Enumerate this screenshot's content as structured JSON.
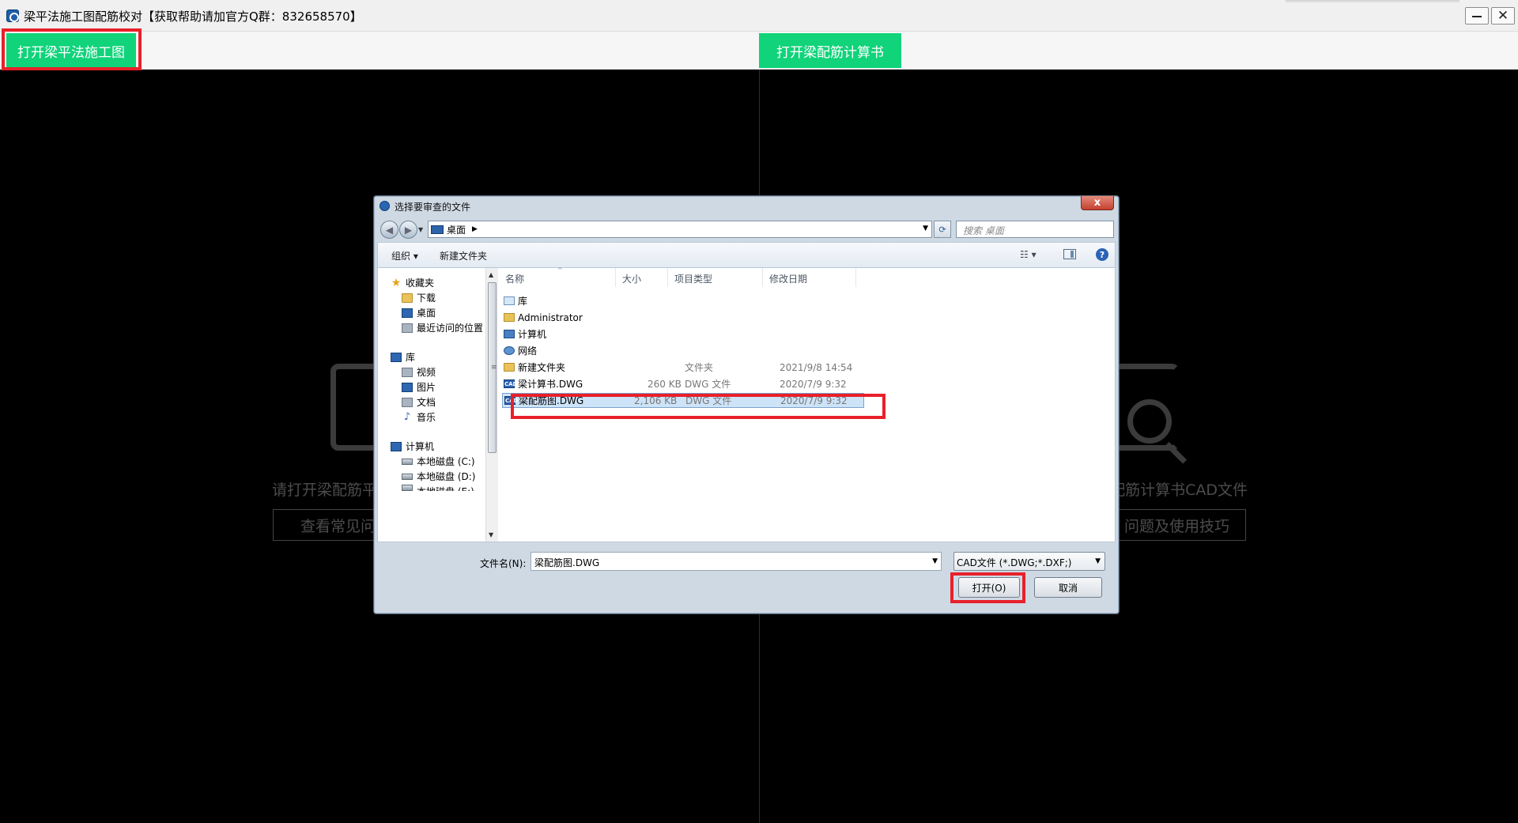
{
  "window": {
    "title": "梁平法施工图配筋校对【获取帮助请加官方Q群：832658570】",
    "minimize": "",
    "close": "✕"
  },
  "toolbar": {
    "open_plan_label": "打开梁平法施工图",
    "open_calc_label": "打开梁配筋计算书"
  },
  "placeholder": {
    "left_text": "请打开梁配筋平",
    "left_button": "查看常见问",
    "right_text": "配筋计算书CAD文件",
    "right_button": "问题及使用技巧"
  },
  "dialog": {
    "title": "选择要审查的文件",
    "close": "x",
    "address": "桌面",
    "search_placeholder": "搜索 桌面",
    "commands": {
      "organize": "组织 ▾",
      "new_folder": "新建文件夹",
      "views": "☷ ▾",
      "help": "?"
    },
    "nav": {
      "favorites": "收藏夹",
      "downloads": "下载",
      "desktop": "桌面",
      "recent": "最近访问的位置",
      "libraries": "库",
      "videos": "视频",
      "pictures": "图片",
      "documents": "文档",
      "music": "音乐",
      "computer": "计算机",
      "drive_c": "本地磁盘 (C:)",
      "drive_d": "本地磁盘 (D:)",
      "drive_e": "本地磁盘 (E:)"
    },
    "columns": {
      "name": "名称",
      "size": "大小",
      "type": "项目类型",
      "modified": "修改日期"
    },
    "files": [
      {
        "name": "库",
        "size": "",
        "type": "",
        "modified": ""
      },
      {
        "name": "Administrator",
        "size": "",
        "type": "",
        "modified": ""
      },
      {
        "name": "计算机",
        "size": "",
        "type": "",
        "modified": ""
      },
      {
        "name": "网络",
        "size": "",
        "type": "",
        "modified": ""
      },
      {
        "name": "新建文件夹",
        "size": "",
        "type": "文件夹",
        "modified": "2021/9/8 14:54"
      },
      {
        "name": "梁计算书.DWG",
        "size": "260 KB",
        "type": "DWG 文件",
        "modified": "2020/7/9 9:32"
      },
      {
        "name": "梁配筋图.DWG",
        "size": "2,106 KB",
        "type": "DWG 文件",
        "modified": "2020/7/9 9:32"
      }
    ],
    "filename_label": "文件名(N):",
    "filename_value": "梁配筋图.DWG",
    "filter_value": "CAD文件 (*.DWG;*.DXF;)",
    "open_button": "打开(O)",
    "cancel_button": "取消"
  },
  "colors": {
    "accent_green": "#10d37a",
    "highlight_red": "#e8202a",
    "background": "#000000"
  }
}
